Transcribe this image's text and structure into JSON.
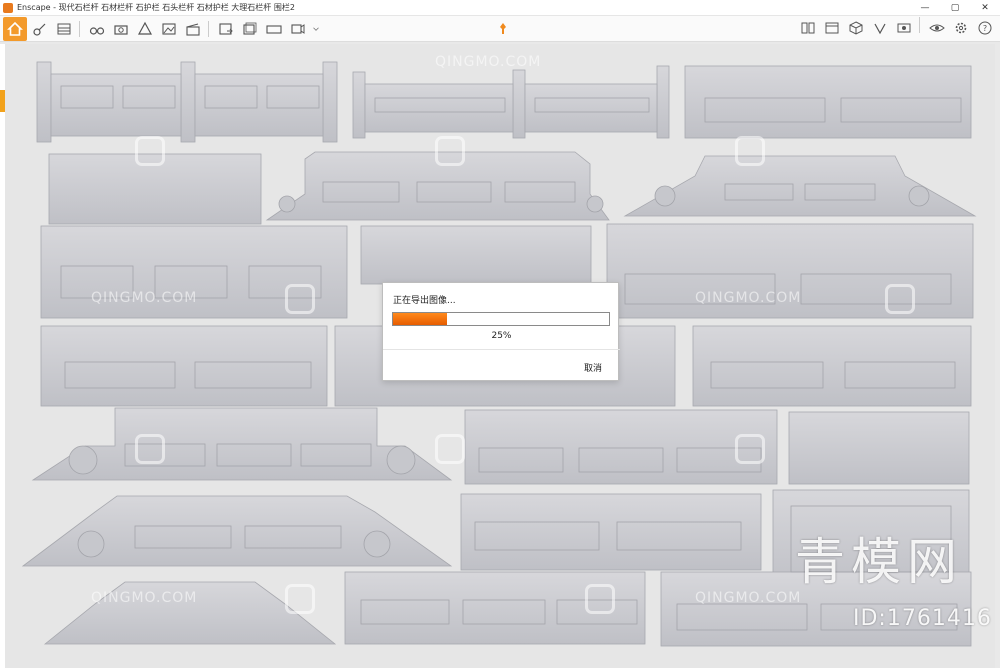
{
  "window": {
    "title": "Enscape - 现代石栏杆 石材栏杆 石护栏 石头栏杆 石材护栏 大理石栏杆 围栏2",
    "controls": [
      "—",
      "▢",
      "✕"
    ]
  },
  "toolbar": {
    "left_icons": [
      "home-icon",
      "tag-icon",
      "bim-icon",
      "binoculars-icon",
      "camera-icon",
      "pyramid-icon",
      "landscape-icon",
      "clapper-icon",
      "export-image-icon",
      "export-batch-icon",
      "export-panorama-icon",
      "export-video-icon"
    ],
    "right_icons": [
      "book-icon",
      "window-icon",
      "cube-icon",
      "asset-icon",
      "settings-export-icon",
      "eye-icon",
      "gear-icon",
      "help-icon"
    ]
  },
  "dialog": {
    "title": "正在导出图像...",
    "progress": 0.25,
    "percent_label": "25%",
    "cancel_label": "取消"
  },
  "watermark": {
    "site": "QINGMO.COM",
    "brand": "青模网",
    "id_label": "ID:1761416"
  },
  "colors": {
    "accent": "#f39a2b",
    "progress": "#f07d10"
  }
}
